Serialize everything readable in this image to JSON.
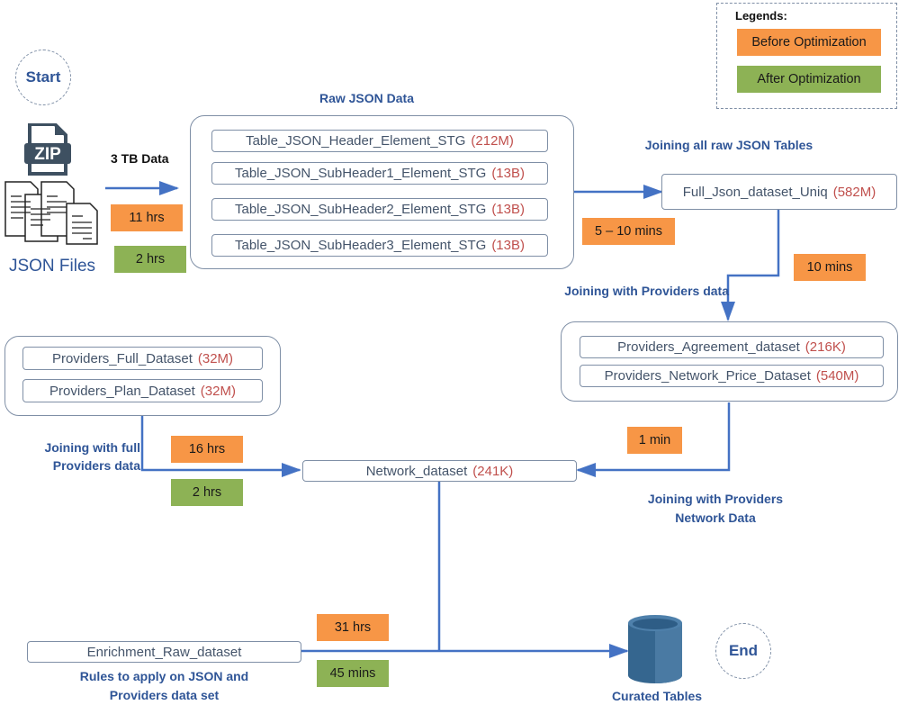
{
  "colors": {
    "before": "#f79646",
    "after": "#8db255",
    "flow": "#4472c4",
    "title": "#2f5597",
    "size": "#c0504d"
  },
  "legend": {
    "title": "Legends:",
    "before_label": "Before Optimization",
    "after_label": "After Optimization"
  },
  "start": {
    "label": "Start"
  },
  "end": {
    "label": "End"
  },
  "source": {
    "zip_icon_text": "ZIP",
    "label": "JSON Files",
    "transfer_label": "3 TB Data",
    "before_time": "11 hrs",
    "after_time": "2 hrs"
  },
  "raw_json": {
    "title": "Raw JSON Data",
    "tables": [
      {
        "name": "Table_JSON_Header_Element_STG",
        "size": "(212M)"
      },
      {
        "name": "Table_JSON_SubHeader1_Element_STG",
        "size": "(13B)"
      },
      {
        "name": "Table_JSON_SubHeader2_Element_STG",
        "size": "(13B)"
      },
      {
        "name": "Table_JSON_SubHeader3_Element_STG",
        "size": "(13B)"
      }
    ]
  },
  "join_raw": {
    "title": "Joining all raw JSON Tables",
    "before_time": "5 – 10 mins",
    "output": {
      "name": "Full_Json_dataset_Uniq",
      "size": "(582M)"
    }
  },
  "join_providers": {
    "title": "Joining with Providers data",
    "before_time": "10 mins",
    "tables": [
      {
        "name": "Providers_Agreement_dataset",
        "size": "(216K)"
      },
      {
        "name": "Providers_Network_Price_Dataset",
        "size": "(540M)"
      }
    ]
  },
  "providers_full": {
    "tables": [
      {
        "name": "Providers_Full_Dataset",
        "size": "(32M)"
      },
      {
        "name": "Providers_Plan_Dataset",
        "size": "(32M)"
      }
    ],
    "title_line1": "Joining with full",
    "title_line2": "Providers data",
    "before_time": "16 hrs",
    "after_time": "2 hrs"
  },
  "network": {
    "output": {
      "name": "Network_dataset",
      "size": "(241K)"
    },
    "title_line1": "Joining with Providers",
    "title_line2": "Network Data",
    "before_time": "1 min"
  },
  "enrichment": {
    "name": "Enrichment_Raw_dataset",
    "title_line1": "Rules to apply on JSON and",
    "title_line2": "Providers data set",
    "before_time": "31 hrs",
    "after_time": "45 mins"
  },
  "curated": {
    "label": "Curated Tables"
  }
}
